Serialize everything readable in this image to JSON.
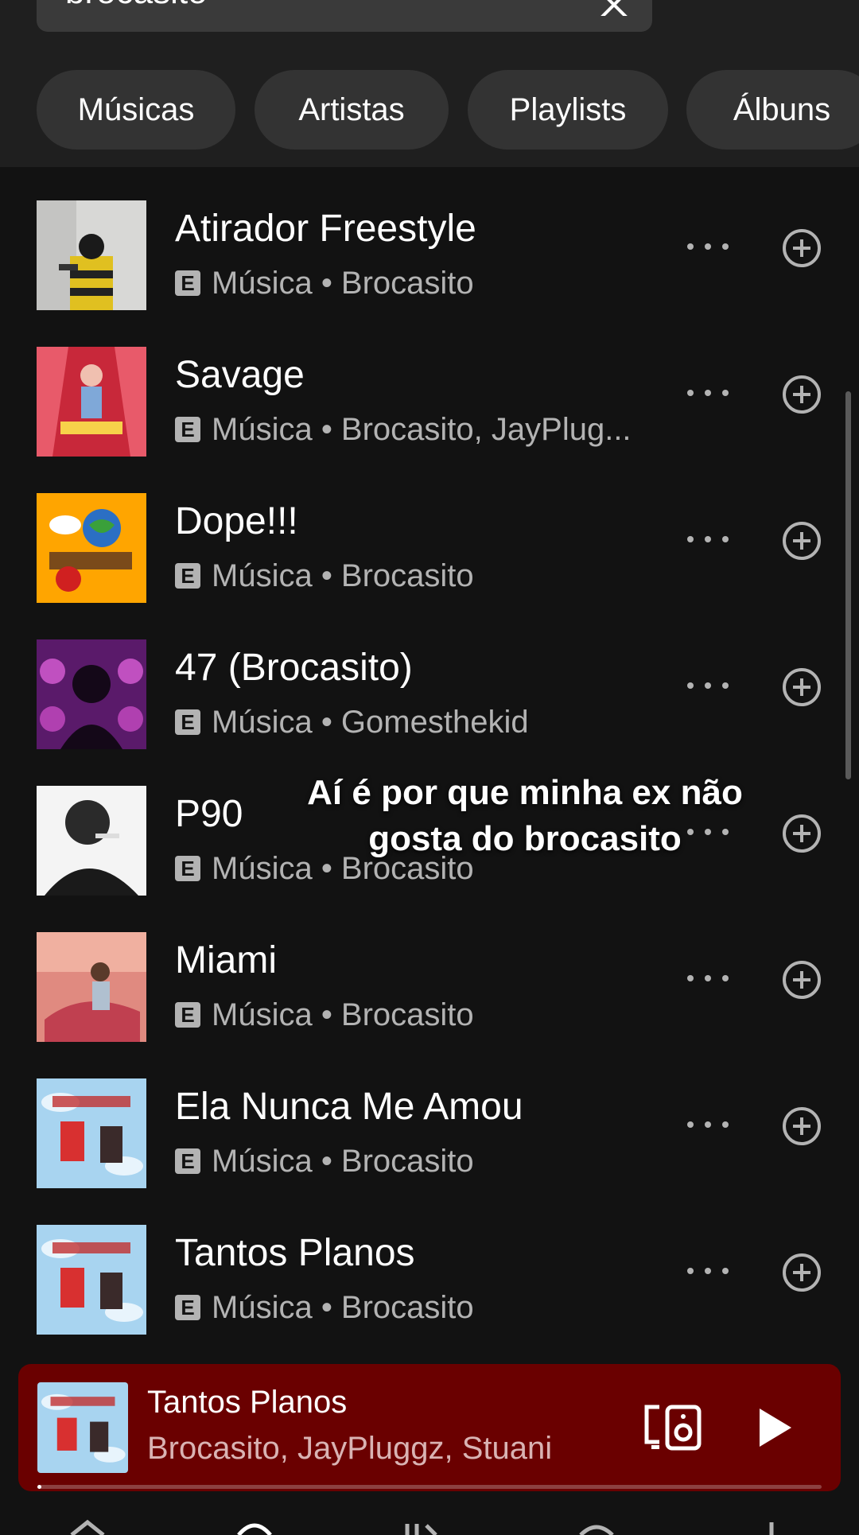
{
  "search": {
    "value": "brocasito",
    "cancel_label": "Cancelar"
  },
  "filters": [
    "Músicas",
    "Artistas",
    "Playlists",
    "Álbuns"
  ],
  "explicit_badge": "E",
  "results": [
    {
      "title": "Atirador Freestyle",
      "subtitle": "Música • Brocasito",
      "cover": "photo-person-yellow-shirt"
    },
    {
      "title": "Savage",
      "subtitle": "Música • Brocasito, JayPlug...",
      "cover": "red-savage-artwork"
    },
    {
      "title": "Dope!!!",
      "subtitle": "Música • Brocasito",
      "cover": "orange-cartoon-artwork"
    },
    {
      "title": "47 (Brocasito)",
      "subtitle": "Música • Gomesthekid",
      "cover": "pink-skulls-artwork"
    },
    {
      "title": "P90",
      "subtitle": "Música • Brocasito",
      "cover": "bw-portrait-smoking"
    },
    {
      "title": "Miami",
      "subtitle": "Música • Brocasito",
      "cover": "salmon-painting-artwork"
    },
    {
      "title": "Ela Nunca Me Amou",
      "subtitle": "Música • Brocasito",
      "cover": "light-blue-cartoon-artwork"
    },
    {
      "title": "Tantos Planos",
      "subtitle": "Música • Brocasito",
      "cover": "light-blue-cartoon-artwork"
    }
  ],
  "overlay_caption": "Aí é por que minha ex não gosta do brocasito",
  "now_playing": {
    "title": "Tantos Planos",
    "artist": "Brocasito, JayPluggz, Stuani",
    "progress": 0.005
  },
  "colors": {
    "background": "#121212",
    "chip": "#333333",
    "player": "#6a0000",
    "secondary_text": "#b3b3b3"
  },
  "icons": [
    "clear-icon",
    "more-options-icon",
    "add-to-playlist-icon",
    "connect-device-icon",
    "play-icon"
  ]
}
